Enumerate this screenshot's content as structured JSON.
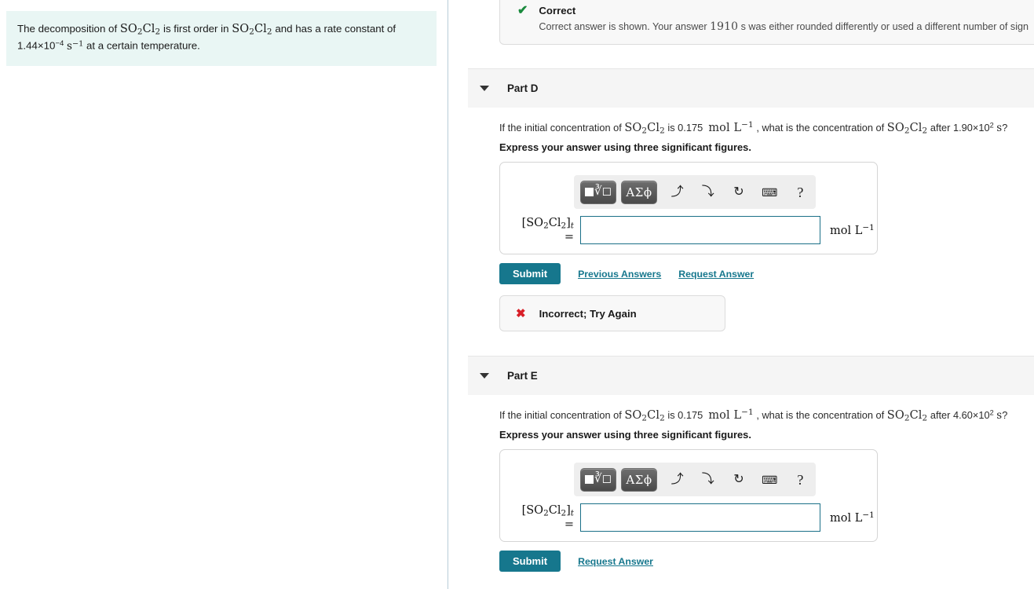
{
  "problem": {
    "line1_pre": "The decomposition of ",
    "line1_f1": "SO",
    "line1_f1_sub": "2",
    "line1_f1b": "Cl",
    "line1_f1b_sub": "2",
    "line1_mid": " is first order in ",
    "line1_post": " and has a rate constant of",
    "rate_value": "1.44×10",
    "rate_exp": "−4",
    "rate_unit": "s",
    "rate_unit_exp": "−1",
    "line2_tail": " at a certain temperature."
  },
  "correct_banner": {
    "icon": "check-icon",
    "title": "Correct",
    "message_pre": "Correct answer is shown. Your answer ",
    "message_value": "1910",
    "message_post": " s was either rounded differently or used a different number of sign"
  },
  "parts": [
    {
      "id": "D",
      "header_label": "Part D",
      "caret_icon": "chevron-down-icon",
      "question": {
        "pre": "If the initial concentration of ",
        "species": "SO₂Cl₂",
        "is": " is 0.175 ",
        "unit": "mol L",
        "unit_exp": "−1",
        "mid": ", what is the concentration of ",
        "after": " after ",
        "time_value": "1.90×10",
        "time_exp": "2",
        "time_unit": "s",
        "qmark": "?"
      },
      "instruction": "Express your answer using three significant figures.",
      "answer": {
        "label_species": "SO₂Cl₂",
        "label_sub": "t",
        "label_eq": "=",
        "value": "",
        "placeholder": "",
        "unit": "mol L",
        "unit_exp": "−1"
      },
      "toolbar": {
        "template_button": "template-button",
        "greek_button": "ΑΣϕ",
        "undo": "↶",
        "redo": "↷",
        "reset": "↻",
        "keyboard": "⌨",
        "help": "?"
      },
      "actions": {
        "submit_label": "Submit",
        "links": [
          "Previous Answers",
          "Request Answer"
        ]
      },
      "feedback": {
        "icon": "x-icon",
        "text": "Incorrect; Try Again"
      }
    },
    {
      "id": "E",
      "header_label": "Part E",
      "caret_icon": "chevron-down-icon",
      "question": {
        "pre": "If the initial concentration of ",
        "species": "SO₂Cl₂",
        "is": " is 0.175 ",
        "unit": "mol L",
        "unit_exp": "−1",
        "mid": ", what is the concentration of ",
        "after": " after ",
        "time_value": "4.60×10",
        "time_exp": "2",
        "time_unit": "s",
        "qmark": "?"
      },
      "instruction": "Express your answer using three significant figures.",
      "answer": {
        "label_species": "SO₂Cl₂",
        "label_sub": "t",
        "label_eq": "=",
        "value": "",
        "placeholder": "",
        "unit": "mol L",
        "unit_exp": "−1"
      },
      "toolbar": {
        "template_button": "template-button",
        "greek_button": "ΑΣϕ",
        "undo": "↶",
        "redo": "↷",
        "reset": "↻",
        "keyboard": "⌨",
        "help": "?"
      },
      "actions": {
        "submit_label": "Submit",
        "links": [
          "Request Answer"
        ]
      },
      "feedback": null
    }
  ],
  "colors": {
    "accent_teal": "#16778d",
    "problem_bg": "#e9f6f4",
    "correct_green": "#1a8a3d",
    "incorrect_red": "#d81f28",
    "header_band": "#f5f5f5",
    "divider": "#b8cdd8"
  }
}
